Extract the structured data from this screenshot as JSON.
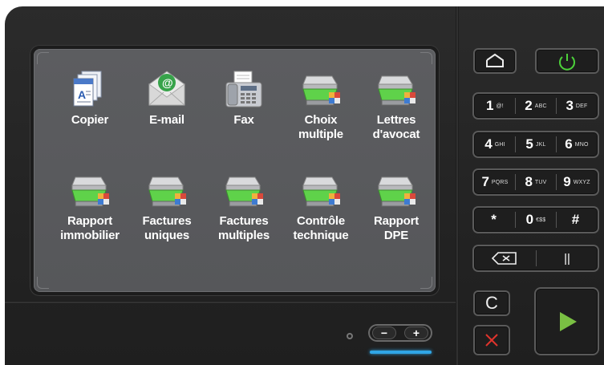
{
  "apps": [
    {
      "id": "copier",
      "label1": "Copier",
      "label2": ""
    },
    {
      "id": "email",
      "label1": "E-mail",
      "label2": ""
    },
    {
      "id": "fax",
      "label1": "Fax",
      "label2": ""
    },
    {
      "id": "choix",
      "label1": "Choix",
      "label2": "multiple"
    },
    {
      "id": "lettres",
      "label1": "Lettres",
      "label2": "d'avocat"
    },
    {
      "id": "rapport-immo",
      "label1": "Rapport",
      "label2": "immobilier"
    },
    {
      "id": "factures-uniques",
      "label1": "Factures",
      "label2": "uniques"
    },
    {
      "id": "factures-multiples",
      "label1": "Factures",
      "label2": "multiples"
    },
    {
      "id": "controle",
      "label1": "Contrôle",
      "label2": "technique"
    },
    {
      "id": "rapport-dpe",
      "label1": "Rapport",
      "label2": "DPE"
    }
  ],
  "keypad": {
    "row1": [
      {
        "num": "1",
        "sub": "@!"
      },
      {
        "num": "2",
        "sub": "ABC"
      },
      {
        "num": "3",
        "sub": "DEF"
      }
    ],
    "row2": [
      {
        "num": "4",
        "sub": "GHI"
      },
      {
        "num": "5",
        "sub": "JKL"
      },
      {
        "num": "6",
        "sub": "MNO"
      }
    ],
    "row3": [
      {
        "num": "7",
        "sub": "PQRS"
      },
      {
        "num": "8",
        "sub": "TUV"
      },
      {
        "num": "9",
        "sub": "WXYZ"
      }
    ],
    "row4": [
      {
        "num": "*",
        "sub": ""
      },
      {
        "num": "0",
        "sub": "€$$"
      },
      {
        "num": "#",
        "sub": ""
      }
    ]
  },
  "controls": {
    "clear_label": "C",
    "volume_minus": "−",
    "volume_plus": "+",
    "pause_label": "||"
  },
  "colors": {
    "accent_green": "#5fd24a",
    "power_green": "#4cd13a",
    "stop_red": "#e0342c",
    "volume_blue": "#30a6e6"
  },
  "icons": {
    "home": "home-icon",
    "power": "power-icon",
    "backspace": "backspace-icon",
    "start": "play-icon",
    "stop": "close-icon"
  }
}
